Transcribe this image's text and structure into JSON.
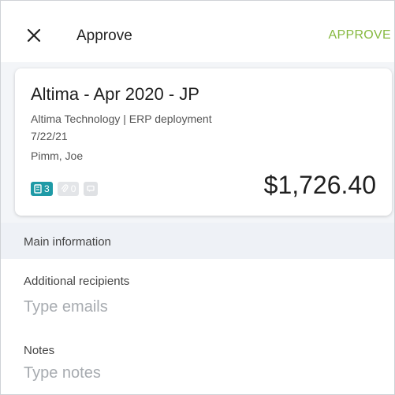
{
  "header": {
    "title": "Approve",
    "approve_label": "APPROVE",
    "accent_color": "#86b93f"
  },
  "report": {
    "title": "Altima - Apr 2020 - JP",
    "company_project": "Altima Technology | ERP deployment",
    "date": "7/22/21",
    "owner": "Pimm, Joe",
    "receipts_count": "3",
    "attachments_count": "0",
    "amount": "$1,726.40"
  },
  "section": {
    "title": "Main information"
  },
  "form": {
    "recipients_label": "Additional recipients",
    "recipients_placeholder": "Type emails",
    "notes_label": "Notes",
    "notes_placeholder": "Type notes"
  },
  "icons": [
    "close-icon",
    "receipt-icon",
    "attachment-icon",
    "comment-icon"
  ]
}
